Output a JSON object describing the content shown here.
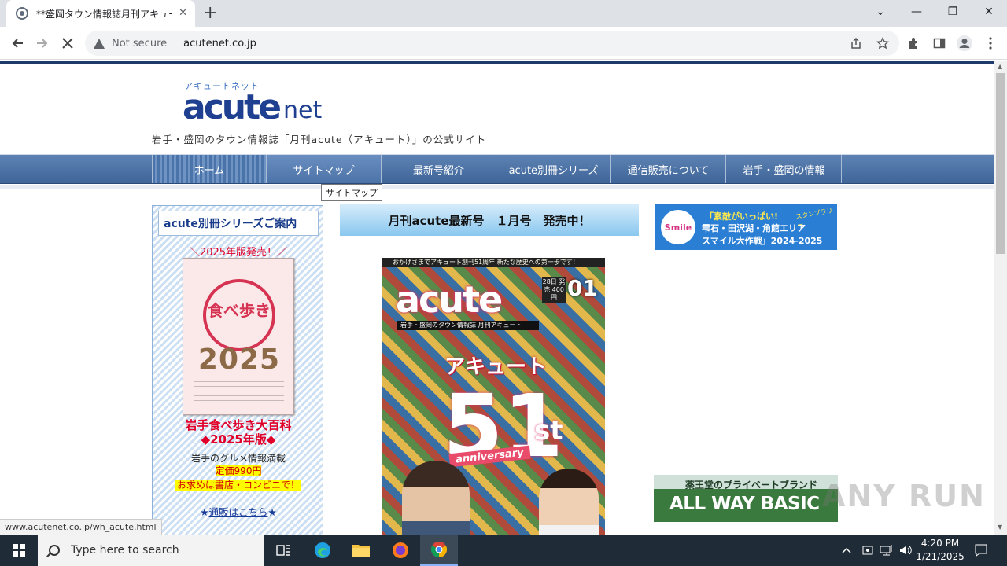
{
  "browser": {
    "tab_title": "**盛岡タウン情報誌月刊アキュート(",
    "tab_close": "✕",
    "new_tab": "+",
    "security_label": "Not secure",
    "url": "acutenet.co.jp",
    "status_url": "www.acutenet.co.jp/wh_acute.html",
    "window_controls": {
      "collapse": "⌄",
      "minimize": "—",
      "restore": "❐",
      "close": "✕"
    }
  },
  "site": {
    "logo_kana": "アキュートネット",
    "logo_main": "acute",
    "logo_net": "net",
    "tagline": "岩手・盛岡のタウン情報誌「月刊acute（アキュート）」の公式サイト",
    "nav": [
      {
        "label": "ホーム"
      },
      {
        "label": "サイトマップ"
      },
      {
        "label": "最新号紹介"
      },
      {
        "label": "acute別冊シリーズ"
      },
      {
        "label": "通信販売について"
      },
      {
        "label": "岩手・盛岡の情報"
      }
    ],
    "tooltip": "サイトマップ"
  },
  "sidebar": {
    "heading": "acute別冊シリーズご案内",
    "new_label": "＼2025年版発売！／",
    "book_title": "食べ歩き",
    "book_year": "2025",
    "title_line1": "岩手食べ歩き大百科",
    "title_line2": "◆2025年版◆",
    "desc": "岩手のグルメ情報満載",
    "price": "定価990円",
    "where": "お求めは書店・コンビニで！",
    "mail_prefix": "★",
    "mail_link": "通販はこちら",
    "mail_suffix": "★"
  },
  "main": {
    "issue_banner": "月刊acute最新号　１月号　発売中！",
    "cover": {
      "top_strip": "おかげさまでアキュート創刊51周年 新たな歴史への第一歩です！",
      "logo": "acute",
      "subtitle": "岩手・盛岡のタウン情報誌 月刊アキュート",
      "issue_number": "01",
      "date_box": "28日 発売 400円",
      "kana": "アキュート",
      "big_number": "51",
      "suffix": "st",
      "anniversary": "anniversary"
    }
  },
  "ads": {
    "smile": {
      "circle": "Smile",
      "line1": "「素敵がいっぱい!",
      "line2": "雫石・田沢湖・角館エリア",
      "line3": "スマイル大作戦」2024-2025",
      "tag": "スタンプラリー"
    },
    "allway": {
      "brand": "薬王堂のプライベートブランド",
      "main": "ALL WAY BASIC"
    }
  },
  "watermark": "ANY RUN",
  "taskbar": {
    "search_placeholder": "Type here to search",
    "time": "4:20 PM",
    "date": "1/21/2025"
  }
}
